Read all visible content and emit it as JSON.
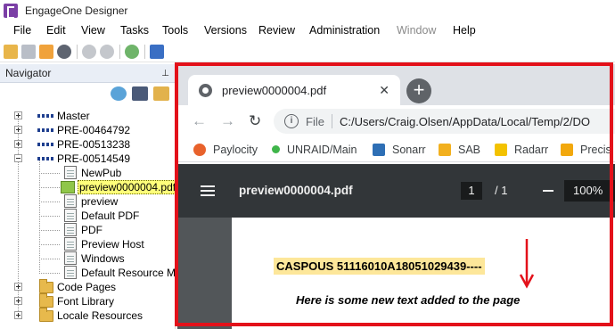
{
  "app": {
    "title": "EngageOne Designer",
    "icon": "engageone-logo-icon"
  },
  "menu": {
    "items": [
      "File",
      "Edit",
      "View",
      "Tasks",
      "Tools",
      "Versions",
      "Review",
      "Administration",
      "Window",
      "Help"
    ],
    "disabled": [
      "Window"
    ]
  },
  "toolbar": {
    "icons": [
      "open-folder-icon",
      "save-icon",
      "publish-icon",
      "link-icon",
      "gear-icon",
      "gear-icon",
      "clock-icon",
      "help-icon"
    ]
  },
  "navigator": {
    "title": "Navigator",
    "pin": "📌",
    "tools": [
      "refresh-icon",
      "binoculars-icon",
      "folder-tools-icon"
    ],
    "tree": [
      {
        "label": "Master",
        "type": "node"
      },
      {
        "label": "PRE-00464792",
        "type": "node"
      },
      {
        "label": "PRE-00513238",
        "type": "node"
      },
      {
        "label": "PRE-00514549",
        "type": "node"
      },
      {
        "label": "NewPub",
        "type": "doc"
      },
      {
        "label": "preview0000004.pdf",
        "type": "pdf",
        "selected": true
      },
      {
        "label": "preview",
        "type": "doc"
      },
      {
        "label": "Default PDF",
        "type": "doc"
      },
      {
        "label": "PDF",
        "type": "doc"
      },
      {
        "label": "Preview Host",
        "type": "doc"
      },
      {
        "label": "Windows",
        "type": "doc"
      },
      {
        "label": "Default Resource Map",
        "type": "doc"
      },
      {
        "label": "Code Pages",
        "type": "folder"
      },
      {
        "label": "Font Library",
        "type": "folder"
      },
      {
        "label": "Locale Resources",
        "type": "folder"
      }
    ]
  },
  "browser": {
    "tab_title": "preview0000004.pdf",
    "close": "✕",
    "new_tab": "+",
    "back": "←",
    "forward": "→",
    "reload": "↻",
    "info": "i",
    "scheme_label": "File",
    "url": "C:/Users/Craig.Olsen/AppData/Local/Temp/2/DO",
    "bookmarks": [
      {
        "label": "Paylocity",
        "color": "#e8622c"
      },
      {
        "label": "UNRAID/Main",
        "color": "#3fb54a"
      },
      {
        "label": "Sonarr",
        "color": "#2e6fb5"
      },
      {
        "label": "SAB",
        "color": "#f2b01e"
      },
      {
        "label": "Radarr",
        "color": "#f3c200"
      },
      {
        "label": "Precis",
        "color": "#f2a80d"
      }
    ]
  },
  "pdf": {
    "title": "preview0000004.pdf",
    "page_current": "1",
    "page_total": "/ 1",
    "zoom": "100%",
    "caspous_text": "CASPOUS 51116010A18051029439----",
    "added_text": "Here is some new text added to the page"
  },
  "colors": {
    "highlight": "#e3111a",
    "selection": "#ffff7a",
    "pdf_toolbar": "#323639"
  }
}
